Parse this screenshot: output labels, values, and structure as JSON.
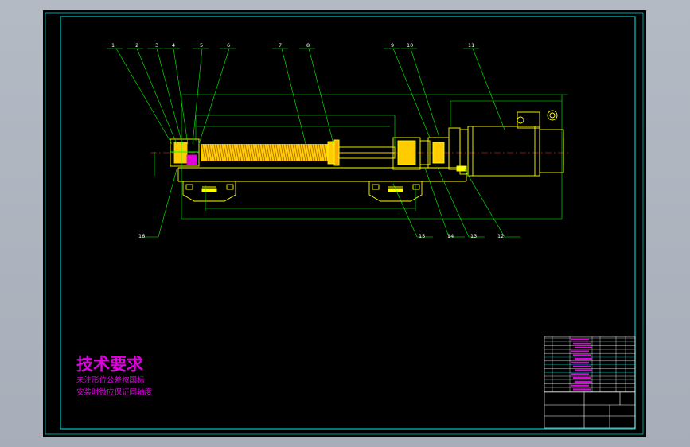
{
  "tech_requirements": {
    "title": "技术要求",
    "line1": "未注形位公差按国标",
    "line2": "安装时微应保证同轴度"
  },
  "balloons_top": [
    "1",
    "2",
    "3",
    "4",
    "5",
    "6",
    "7",
    "8",
    "9",
    "10",
    "11"
  ],
  "balloons_bottom": [
    "16",
    "15",
    "14",
    "13",
    "12"
  ],
  "colors": {
    "background": "#000000",
    "frame": "#ffffff",
    "green": "#00ff00",
    "yellow": "#ffff00",
    "magenta": "#e000e0",
    "cyan": "#00c8c8",
    "red": "#ff3030"
  }
}
